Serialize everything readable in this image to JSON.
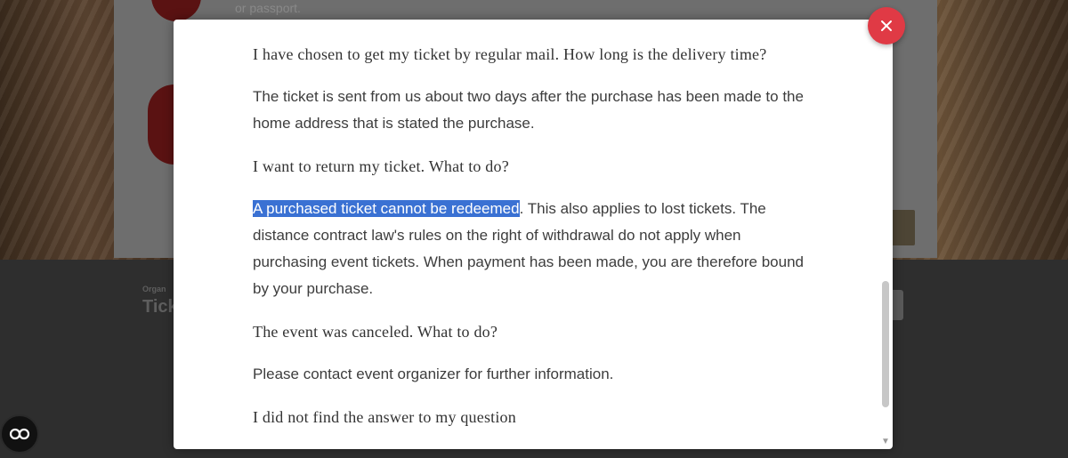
{
  "faq": [
    {
      "question": "I have chosen to get my ticket by regular mail. How long is the delivery time?",
      "answer": "The ticket is sent from us about two days after the purchase has been made to the home address that is stated the purchase."
    },
    {
      "question": "I want to return my ticket. What to do?",
      "answer_highlighted": "A purchased ticket cannot be redeemed",
      "answer_rest": ". This also applies to lost tickets. The distance contract law's rules on the right of withdrawal do not apply when purchasing event tickets. When payment has been made, you are therefore bound by your purchase."
    },
    {
      "question": "The event was canceled. What to do?",
      "answer": "Please contact event organizer for further information."
    },
    {
      "question": "I did not find the answer to my question"
    }
  ],
  "background": {
    "partial_text_top": "or passport.",
    "bottom_label_small": "Organ",
    "bottom_label_big": "Tick"
  },
  "controls": {
    "close_icon": "close-icon",
    "accessibility_icon": "accessibility-icon"
  },
  "colors": {
    "close_button": "#e03a45",
    "highlight": "#3a71d3"
  }
}
